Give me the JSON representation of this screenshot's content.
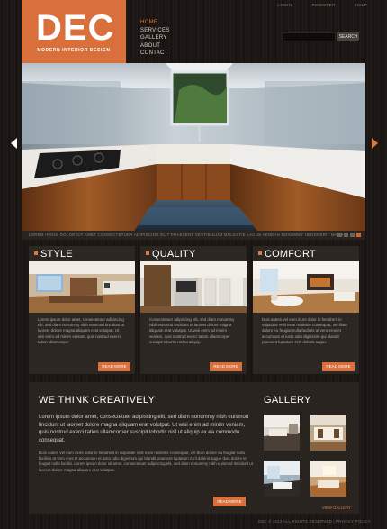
{
  "brand": {
    "name": "DEC",
    "tagline": "MODERN INTERIOR DESIGN",
    "accent": "#d9703c"
  },
  "main_nav": [
    {
      "label": "HOME",
      "active": true
    },
    {
      "label": "SERVICES",
      "active": false
    },
    {
      "label": "GALLERY",
      "active": false
    },
    {
      "label": "ABOUT",
      "active": false
    },
    {
      "label": "CONTACT",
      "active": false
    }
  ],
  "top_nav": [
    "LOGIN",
    "REGISTER",
    "HELP"
  ],
  "search": {
    "placeholder": "",
    "button": "SEARCH"
  },
  "slider": {
    "caption": "LOREM IPSUM DOLOR SIT AMET CONSECTETUER ADIPISCING ELIT PRAESENT VESTIBULUM MOLESTIE LACUS AENEAN NONUMMY HENDRERIT MAURIS",
    "dot_count": 4,
    "active_dot": 1
  },
  "features": [
    {
      "title": "STYLE",
      "text": "Lorem ipsum dolor amet, consectetuer adipiscing elit, sed diam nonummy nibh euismod tincidunt ut laoreet dolore magna aliquam erat volutpat. Ut wisi enim ad minim veniam, quis nostrud exerci tation ullamcorper",
      "button": "READ MORE"
    },
    {
      "title": "QUALITY",
      "text": "Consectetuer adipiscing elit, sed diam nonummy nibh euismod tincidunt ut laoreet dolore magna aliquam erat volutpat. Ut wisi enim ad minim veniam, quis nostrud exerci tation ullamcorper suscipit lobortis nisl ut aliquip",
      "button": "READ MORE"
    },
    {
      "title": "COMFORT",
      "text": "Duis autem vel eum iriure dolor in hendrerit in vulputate velit esse molestie consequat, vel illum dolore eu feugiat nulla facilisis at vero eros et accumsan et iusto odio dignissim qui blandit praesent luptatum zzril delenit augue",
      "button": "READ MORE"
    }
  ],
  "creative": {
    "title": "WE THINK CREATIVELY",
    "lead": "Lorem ipsum dolor amet, consectetuer adipiscing elit, sed diam nonummy nibh euismod tincidunt ut laoreet dolore magna aliquam erat volutpat. Ut wisi enim ad minim veniam, quis nostrud exerci tation ullamcorper suscipit lobortis nisl ut aliquip ex ea commodo consequat.",
    "body": "Duis autem vel eum iriure dolor in hendrerit in vulputate velit esse molestie consequat, vel illum dolore eu feugiat nulla facilisis at vero eros et accumsan et iusto odio dignissim qui blandit praesent luptatum zzril delenit augue duis dolore te feugait nulla facilisi. Lorem ipsum dolor sit amet, consectetuer adipiscing elit, sed diam nonummy nibh euismod tincidunt ut laoreet dolore magna aliquam erat volutpat.",
    "button": "READ MORE"
  },
  "gallery": {
    "title": "GALLERY",
    "link": "VIEW GALLERY"
  },
  "footer": "DEC © 2012 ALL RIGHTS RESERVED  |  PRIVACY POLICY"
}
